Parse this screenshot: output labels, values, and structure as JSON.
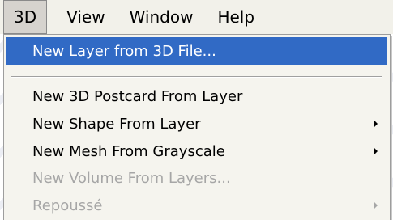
{
  "menubar": {
    "items": [
      {
        "label": "3D"
      },
      {
        "label": "View"
      },
      {
        "label": "Window"
      },
      {
        "label": "Help"
      }
    ]
  },
  "menu": {
    "items": [
      {
        "label": "New Layer from 3D File...",
        "state": "highlighted",
        "submenu": false
      },
      {
        "label": "New 3D Postcard From Layer",
        "state": "enabled",
        "submenu": false
      },
      {
        "label": "New Shape From Layer",
        "state": "enabled",
        "submenu": true
      },
      {
        "label": "New Mesh From Grayscale",
        "state": "enabled",
        "submenu": true
      },
      {
        "label": "New Volume From Layers...",
        "state": "disabled",
        "submenu": false
      },
      {
        "label": "Repoussé",
        "state": "disabled",
        "submenu": true
      }
    ]
  },
  "colors": {
    "highlight": "#316ac5",
    "menubar_bg": "#f2f1ea",
    "menu_bg": "#f5f4ee",
    "disabled_text": "#a6a6a6"
  }
}
